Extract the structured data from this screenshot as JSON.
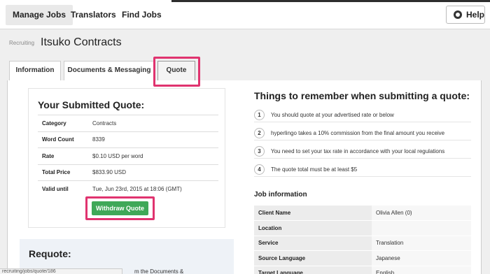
{
  "nav": {
    "items": [
      "Manage Jobs",
      "Translators",
      "Find Jobs"
    ],
    "help_label": "Help"
  },
  "header": {
    "breadcrumb": "Recruiting",
    "title": "Itsuko Contracts"
  },
  "tabs": [
    "Information",
    "Documents & Messaging",
    "Quote"
  ],
  "quote": {
    "title": "Your Submitted Quote:",
    "rows": [
      {
        "label": "Category",
        "value": "Contracts"
      },
      {
        "label": "Word Count",
        "value": "8339"
      },
      {
        "label": "Rate",
        "value": "$0.10 USD per word"
      },
      {
        "label": "Total Price",
        "value": "$833.90 USD"
      },
      {
        "label": "Valid until",
        "value": "Tue, Jun 23rd, 2015 at 18:06 (GMT)"
      }
    ],
    "withdraw_label": "Withdraw Quote"
  },
  "requote": {
    "title": "Requote:",
    "partial_text": "m the Documents &"
  },
  "statusbar": {
    "text": "recruiting/jobs/quote/186"
  },
  "remember": {
    "title": "Things to remember when submitting a quote:",
    "tips": [
      {
        "num": "1",
        "text": "You should quote at your advertised rate or below"
      },
      {
        "num": "2",
        "text": "hyperlingo takes a 10% commission from the final amount you receive"
      },
      {
        "num": "3",
        "text": "You need to set your tax rate in accordance with your local regulations"
      },
      {
        "num": "4",
        "text": "The quote total must be at least $5"
      }
    ]
  },
  "job_info": {
    "title": "Job information",
    "rows": [
      {
        "label": "Client Name",
        "value": "Olivia Allen (0)"
      },
      {
        "label": "Location",
        "value": ""
      },
      {
        "label": "Service",
        "value": "Translation"
      },
      {
        "label": "Source Language",
        "value": "Japanese"
      },
      {
        "label": "Target Language",
        "value": "English"
      }
    ]
  },
  "colors": {
    "highlight": "#e0336f",
    "withdraw_button": "#3fa858"
  }
}
